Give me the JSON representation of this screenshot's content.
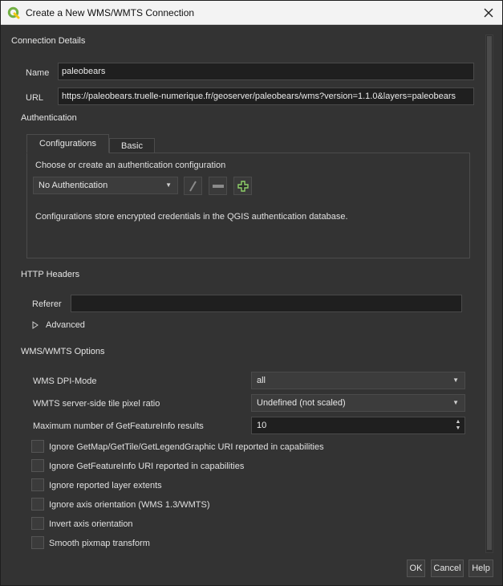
{
  "window": {
    "title": "Create a New WMS/WMTS Connection",
    "icons": {
      "app": "qgis-logo-icon",
      "close": "close-icon"
    },
    "colors": {
      "accent": "#72b043",
      "titlebar": "#f3f3f3",
      "background": "#333333"
    }
  },
  "connection": {
    "section_title": "Connection Details",
    "name_label": "Name",
    "name_value": "paleobears",
    "url_label": "URL",
    "url_value": "https://paleobears.truelle-numerique.fr/geoserver/paleobears/wms?version=1.1.0&layers=paleobears"
  },
  "authentication": {
    "section_title": "Authentication",
    "tabs": [
      "Configurations",
      "Basic"
    ],
    "active_tab": "Configurations",
    "prompt": "Choose or create an authentication configuration",
    "selected": "No Authentication",
    "info": "Configurations store encrypted credentials in the QGIS authentication database.",
    "tool_icons": [
      "edit-pencil-icon",
      "remove-icon",
      "add-icon"
    ]
  },
  "http_headers": {
    "section_title": "HTTP Headers",
    "referer_label": "Referer",
    "referer_value": "",
    "advanced_label": "Advanced"
  },
  "wms_options": {
    "section_title": "WMS/WMTS Options",
    "dpi_mode_label": "WMS DPI-Mode",
    "dpi_mode_value": "all",
    "tile_ratio_label": "WMTS server-side tile pixel ratio",
    "tile_ratio_value": "Undefined (not scaled)",
    "max_results_label": "Maximum number of GetFeatureInfo results",
    "max_results_value": "10",
    "checkboxes": [
      {
        "label": "Ignore GetMap/GetTile/GetLegendGraphic URI reported in capabilities",
        "checked": false
      },
      {
        "label": "Ignore GetFeatureInfo URI reported in capabilities",
        "checked": false
      },
      {
        "label": "Ignore reported layer extents",
        "checked": false
      },
      {
        "label": "Ignore axis orientation (WMS 1.3/WMTS)",
        "checked": false
      },
      {
        "label": "Invert axis orientation",
        "checked": false
      },
      {
        "label": "Smooth pixmap transform",
        "checked": false
      }
    ]
  },
  "buttons": {
    "ok": "OK",
    "cancel": "Cancel",
    "help": "Help"
  }
}
